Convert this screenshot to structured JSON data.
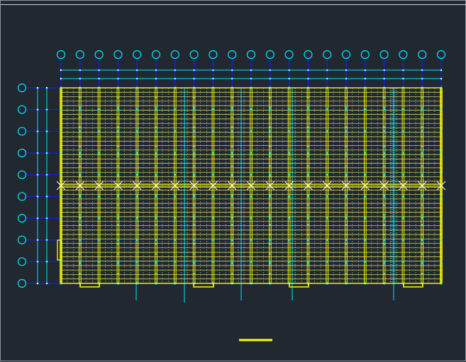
{
  "drawing": {
    "type": "structural-plan",
    "grid_columns": 21,
    "grid_rows": 10,
    "purlin_lines": 44,
    "colors": {
      "background": "#212830",
      "grid": "#00e5ff",
      "members": "#ffff66",
      "accent": "#ffff00",
      "axis_blue": "#1a1aff",
      "white": "#ffffff"
    },
    "icons": [
      "grid-bubble",
      "bracing-x",
      "scale-bar"
    ]
  }
}
